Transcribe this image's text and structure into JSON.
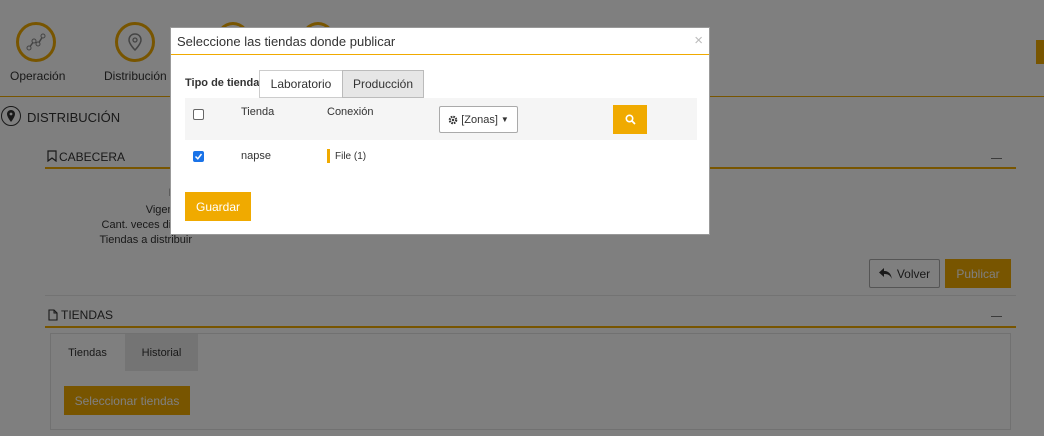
{
  "steps": [
    {
      "label": "Operación",
      "icon": "line-chart-icon"
    },
    {
      "label": "Distribución",
      "icon": "map-pin-icon"
    }
  ],
  "page": {
    "title": "DISTRIBUCIÓN",
    "cabecera": {
      "title": "CABECERA",
      "fields": [
        "Nom",
        "Vigente e",
        "Cant. veces distrib",
        "Tiendas a distribuir"
      ]
    },
    "buttons": {
      "volver": "Volver",
      "publicar": "Publicar"
    },
    "tiendas_section": {
      "title": "TIENDAS",
      "tabs": [
        "Tiendas",
        "Historial"
      ],
      "select_button": "Seleccionar tiendas"
    }
  },
  "modal": {
    "title": "Seleccione las tiendas donde publicar",
    "close": "×",
    "tipo_label": "Tipo de tienda:",
    "tipo_options": [
      "Laboratorio",
      "Producción"
    ],
    "tipo_selected": "Producción",
    "columns": {
      "tienda": "Tienda",
      "conexion": "Conexión"
    },
    "zonas_button": "[Zonas]",
    "rows": [
      {
        "tienda": "napse",
        "conexion": "File (1)",
        "checked": true
      }
    ],
    "save_button": "Guardar"
  },
  "colors": {
    "accent": "#F0AA00",
    "checkbox": "#1a73e8"
  }
}
